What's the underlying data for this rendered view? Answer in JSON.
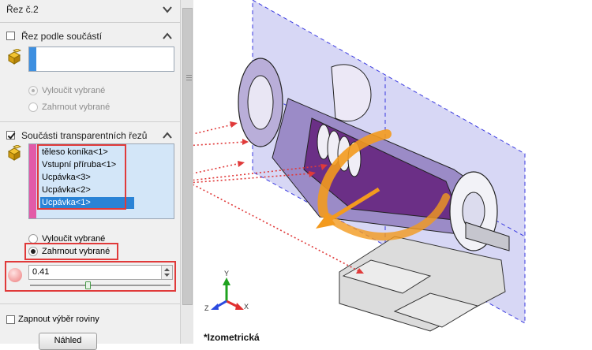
{
  "panel": {
    "section_rez2": {
      "label": "Řez č.2"
    },
    "section_rez_podle": {
      "label": "Řez podle součástí",
      "checked": false,
      "radio_exclude": "Vyloučit vybrané",
      "radio_include": "Zahrnout vybrané"
    },
    "section_transparent": {
      "label": "Součásti transparentních řezů",
      "checked": true,
      "items": [
        "těleso koníka<1>",
        "Vstupní příruba<1>",
        "Ucpávka<3>",
        "Ucpávka<2>",
        "Ucpávka<1>"
      ],
      "selected_index": 4,
      "radio_exclude": "Vyloučit vybrané",
      "radio_include": "Zahrnout vybrané",
      "selected_radio": "Zahrnout vybrané",
      "transparency_value": "0.41",
      "slider_fraction": 0.41
    },
    "plane_select": {
      "label": "Zapnout výběr roviny",
      "checked": false
    },
    "preview_button": "Náhled"
  },
  "viewport": {
    "view_label": "*Izometrická",
    "triad": {
      "x": "X",
      "y": "Y",
      "z": "Z"
    }
  },
  "colors": {
    "highlight_red": "#e03a3a",
    "selection_blue": "#2a83d6",
    "section_plane": "#c9c9f2",
    "model_purple": "#6b2f86",
    "arrow_orange": "#f39a1e"
  }
}
